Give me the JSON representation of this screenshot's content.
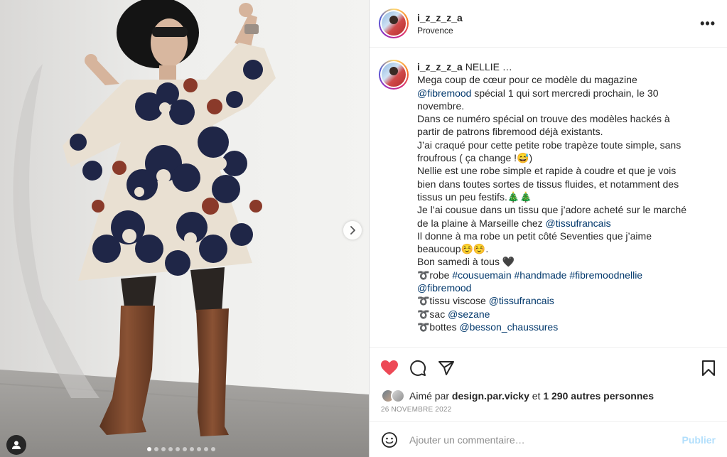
{
  "header": {
    "username": "i_z_z_z_a",
    "location": "Provence",
    "more_label": "•••"
  },
  "caption": {
    "username": "i_z_z_z_a",
    "lines": [
      {
        "parts": [
          {
            "t": "NELLIE …"
          }
        ]
      },
      {
        "parts": [
          {
            "t": "Mega coup de cœur pour ce modèle du magazine"
          }
        ]
      },
      {
        "parts": [
          {
            "t": "@fibremood",
            "m": true
          },
          {
            "t": " spécial 1 qui sort mercredi prochain, le 30"
          }
        ]
      },
      {
        "parts": [
          {
            "t": "novembre."
          }
        ]
      },
      {
        "parts": [
          {
            "t": "Dans ce numéro spécial on trouve des modèles hackés à"
          }
        ]
      },
      {
        "parts": [
          {
            "t": "partir de patrons fibremood déjà existants."
          }
        ]
      },
      {
        "parts": [
          {
            "t": "J’ai craqué pour cette petite robe trapèze toute simple, sans"
          }
        ]
      },
      {
        "parts": [
          {
            "t": "froufrous ( ça change !😅)"
          }
        ]
      },
      {
        "parts": [
          {
            "t": "Nellie est une robe simple et rapide à coudre et que je vois"
          }
        ]
      },
      {
        "parts": [
          {
            "t": "bien dans toutes sortes de tissus fluides, et notamment des"
          }
        ]
      },
      {
        "parts": [
          {
            "t": "tissus un peu festifs.🎄🎄"
          }
        ]
      },
      {
        "parts": [
          {
            "t": "Je l’ai cousue dans un tissu que j’adore acheté sur le marché"
          }
        ]
      },
      {
        "parts": [
          {
            "t": "de la plaine à Marseille chez "
          },
          {
            "t": "@tissufrancais",
            "m": true
          }
        ]
      },
      {
        "parts": [
          {
            "t": "Il donne à ma robe un petit côté Seventies que j’aime"
          }
        ]
      },
      {
        "parts": [
          {
            "t": "beaucoup☺️☺️."
          }
        ]
      },
      {
        "parts": [
          {
            "t": "Bon samedi à tous 🖤"
          }
        ]
      },
      {
        "parts": [
          {
            "t": "➰robe "
          },
          {
            "t": "#cousuemain",
            "m": true
          },
          {
            "t": " "
          },
          {
            "t": "#handmade",
            "m": true
          },
          {
            "t": " "
          },
          {
            "t": "#fibremoodnellie",
            "m": true
          }
        ]
      },
      {
        "parts": [
          {
            "t": "@fibremood",
            "m": true
          }
        ]
      },
      {
        "parts": [
          {
            "t": "➰tissu viscose "
          },
          {
            "t": "@tissufrancais",
            "m": true
          }
        ]
      },
      {
        "parts": [
          {
            "t": "➰sac "
          },
          {
            "t": "@sezane",
            "m": true
          }
        ]
      },
      {
        "parts": [
          {
            "t": "➰bottes "
          },
          {
            "t": "@besson_chaussures",
            "m": true
          }
        ]
      }
    ]
  },
  "actions": {
    "like_icon": "heart-filled-icon",
    "comment_icon": "comment-icon",
    "share_icon": "paper-plane-icon",
    "save_icon": "bookmark-icon",
    "like_color": "#ed4956"
  },
  "likes": {
    "prefix": "Aimé par ",
    "user": "design.par.vicky",
    "middle": " et ",
    "others": "1 290 autres personnes"
  },
  "date": "26 NOVEMBRE 2022",
  "comment": {
    "placeholder": "Ajouter un commentaire…",
    "publish_label": "Publier"
  },
  "carousel": {
    "slide_count": 10,
    "active_index": 0
  }
}
